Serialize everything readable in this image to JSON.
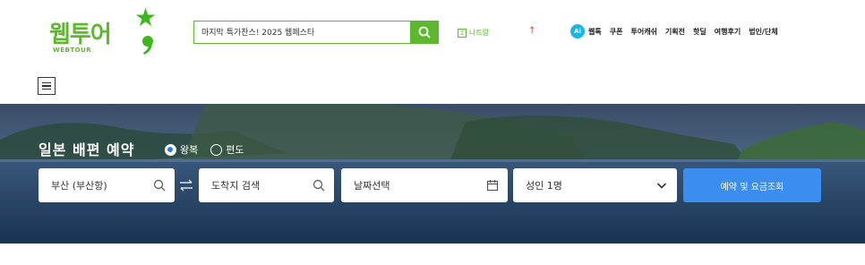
{
  "logo": {
    "text": "웹투어",
    "sub": "WEBTOUR"
  },
  "search": {
    "value": "마지막 특가찬스! 2025 웹페스타",
    "placeholder": ""
  },
  "header_links": {
    "recent_badge": "1",
    "recent_label": "나트랑",
    "rank_arrow": "↑",
    "ai_badge": "Ai",
    "nav": [
      "웹톡",
      "쿠폰",
      "투어캐쉬",
      "기획전",
      "핫딜",
      "여행후기",
      "법인/단체"
    ]
  },
  "hero": {
    "title": "일본 배편 예약",
    "trip_types": [
      {
        "label": "왕복",
        "selected": true
      },
      {
        "label": "편도",
        "selected": false
      }
    ],
    "departure": "부산 (부산항)",
    "arrival_placeholder": "도착지 검색",
    "date_placeholder": "날짜선택",
    "passengers": "성인 1명",
    "submit_label": "예약 및 요금조회"
  },
  "colors": {
    "brand_green": "#5db82f",
    "accent_blue": "#3b8eef",
    "ai_blue": "#19b7e6",
    "rank_red": "#e8412c"
  },
  "icons": [
    "search-icon",
    "menu-icon",
    "swap-icon",
    "calendar-icon",
    "chevron-down-icon",
    "star-icon"
  ]
}
